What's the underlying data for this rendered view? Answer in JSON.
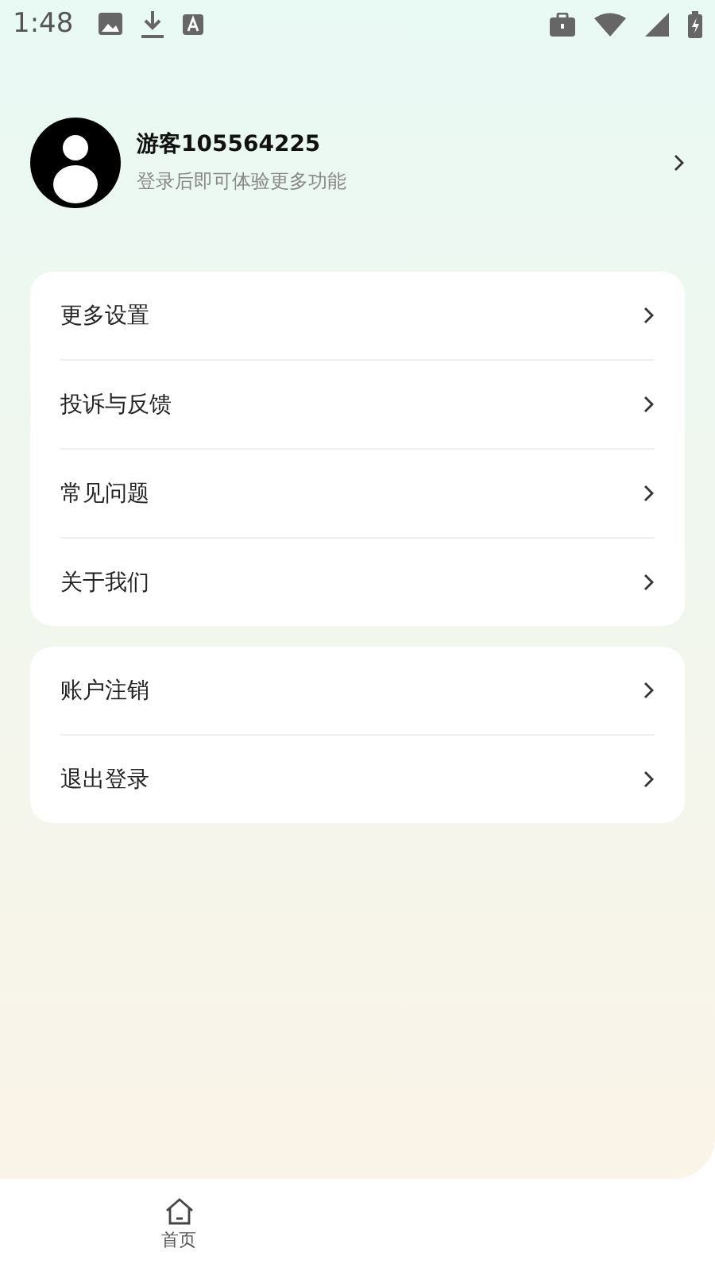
{
  "status_bar": {
    "time": "1:48"
  },
  "profile": {
    "name": "游客105564225",
    "subtitle": "登录后即可体验更多功能"
  },
  "menu_groups": [
    {
      "items": [
        {
          "label": "更多设置"
        },
        {
          "label": "投诉与反馈"
        },
        {
          "label": "常见问题"
        },
        {
          "label": "关于我们"
        }
      ]
    },
    {
      "items": [
        {
          "label": "账户注销"
        },
        {
          "label": "退出登录"
        }
      ]
    }
  ],
  "bottom_nav": [
    {
      "label": "首页"
    }
  ]
}
